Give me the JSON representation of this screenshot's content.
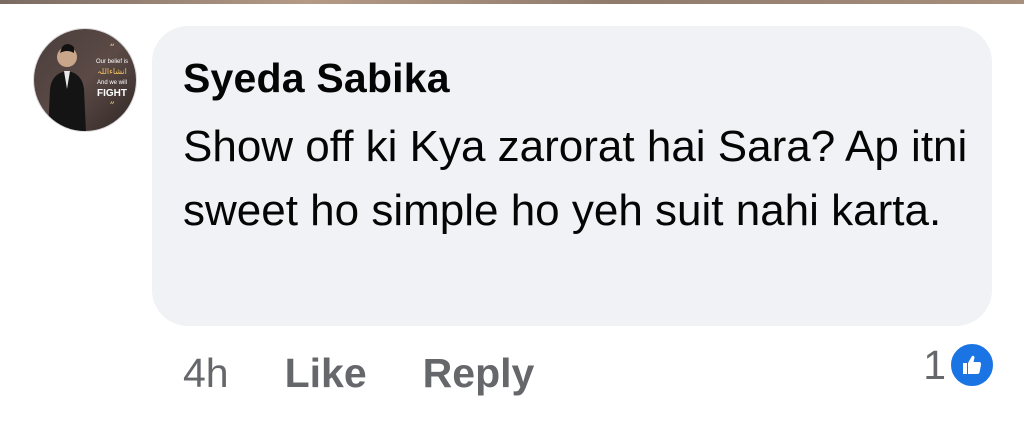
{
  "comment": {
    "author": "Syeda Sabika",
    "text": "Show off ki Kya zarorat hai Sara? Ap itni sweet ho simple ho yeh suit nahi karta.",
    "timestamp": "4h",
    "like_label": "Like",
    "reply_label": "Reply",
    "reaction_count": "1",
    "reaction_icon": "thumbs-up-icon"
  },
  "avatar": {
    "quote_open": "“",
    "line1": "Our belief is",
    "line2": "انشاءاللہ",
    "line3": "And we will",
    "line4": "FIGHT",
    "quote_close": "”"
  },
  "colors": {
    "bubble": "#f0f2f5",
    "text": "#050505",
    "meta": "#65676b",
    "like_blue": "#1b74e4"
  }
}
